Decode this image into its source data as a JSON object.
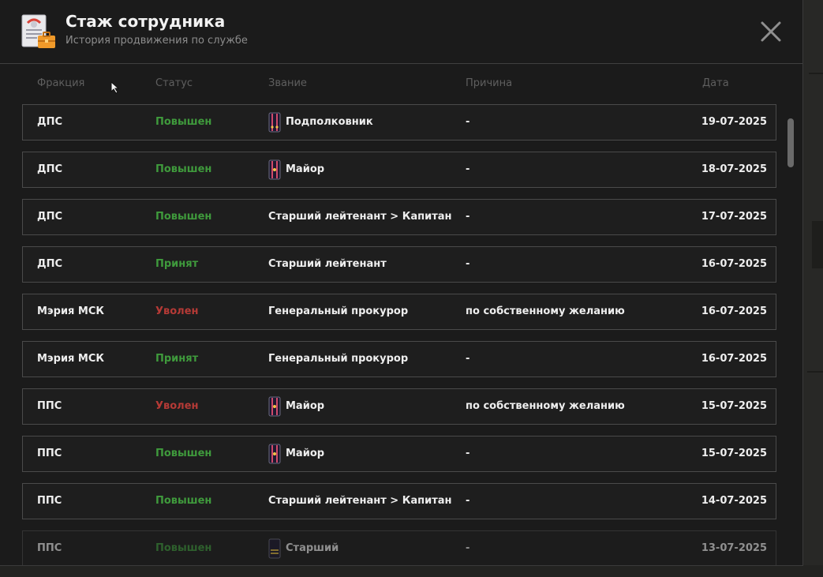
{
  "window": {
    "title": "Стаж сотрудника",
    "subtitle": "История продвижения по службе"
  },
  "icons": {
    "logo": "document-briefcase-icon",
    "close": "close-icon",
    "rank_insignia": "shoulder-strap-icon"
  },
  "colors": {
    "promoted": "#3f9a3c",
    "hired": "#3f9a3c",
    "fired": "#b53a36",
    "header_text": "#5f5f5f"
  },
  "columns": {
    "faction": "Фракция",
    "status": "Статус",
    "rank": "Звание",
    "reason": "Причина",
    "date": "Дата"
  },
  "rows": [
    {
      "faction": "ДПС",
      "status": "Повышен",
      "status_kind": "green",
      "rank": "Подполковник",
      "insignia": "lt-colonel",
      "reason": "-",
      "date": "19-07-2025"
    },
    {
      "faction": "ДПС",
      "status": "Повышен",
      "status_kind": "green",
      "rank": "Майор",
      "insignia": "major",
      "reason": "-",
      "date": "18-07-2025"
    },
    {
      "faction": "ДПС",
      "status": "Повышен",
      "status_kind": "green",
      "rank": "Старший лейтенант > Капитан",
      "insignia": "",
      "reason": "-",
      "date": "17-07-2025"
    },
    {
      "faction": "ДПС",
      "status": "Принят",
      "status_kind": "green",
      "rank": "Старший лейтенант",
      "insignia": "",
      "reason": "-",
      "date": "16-07-2025"
    },
    {
      "faction": "Мэрия МСК",
      "status": "Уволен",
      "status_kind": "red",
      "rank": "Генеральный прокурор",
      "insignia": "",
      "reason": "по собственному желанию",
      "date": "16-07-2025"
    },
    {
      "faction": "Мэрия МСК",
      "status": "Принят",
      "status_kind": "green",
      "rank": "Генеральный прокурор",
      "insignia": "",
      "reason": "-",
      "date": "16-07-2025"
    },
    {
      "faction": "ППС",
      "status": "Уволен",
      "status_kind": "red",
      "rank": "Майор",
      "insignia": "major",
      "reason": "по собственному желанию",
      "date": "15-07-2025"
    },
    {
      "faction": "ППС",
      "status": "Повышен",
      "status_kind": "green",
      "rank": "Майор",
      "insignia": "major",
      "reason": "-",
      "date": "15-07-2025"
    },
    {
      "faction": "ППС",
      "status": "Повышен",
      "status_kind": "green",
      "rank": "Старший лейтенант > Капитан",
      "insignia": "",
      "reason": "-",
      "date": "14-07-2025"
    },
    {
      "faction": "ППС",
      "status": "Повышен",
      "status_kind": "green",
      "rank": "Старший",
      "insignia": "sergeant",
      "reason": "-",
      "date": "13-07-2025"
    }
  ]
}
